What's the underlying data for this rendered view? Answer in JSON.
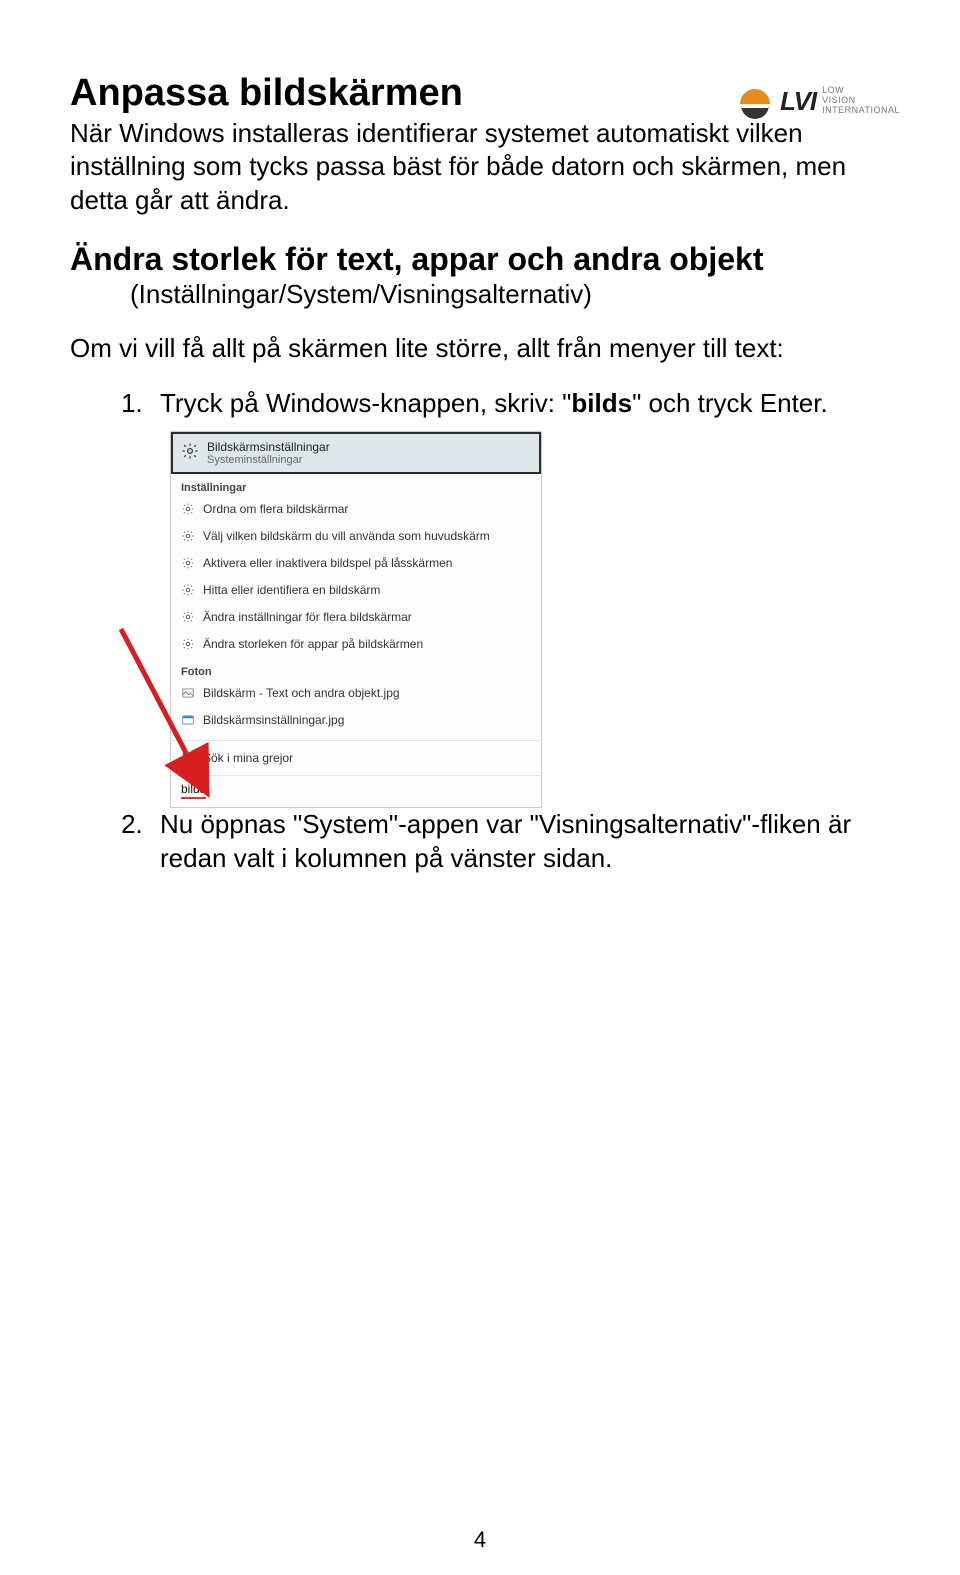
{
  "logo": {
    "brand": "LVI",
    "tag1": "LOW",
    "tag2": "VISION",
    "tag3": "INTERNATIONAL"
  },
  "title": "Anpassa bildskärmen",
  "intro": "När Windows installeras identifierar systemet automatiskt vilken inställning som tycks passa bäst för både datorn och skärmen, men detta går att ändra.",
  "subtitle": "Ändra storlek för text, appar och andra objekt",
  "crumb": "(Inställningar/System/Visningsalternativ)",
  "lead": "Om vi vill få allt på skärmen lite större, allt från menyer till text:",
  "step1a": "Tryck på Windows-knappen, skriv: \"",
  "step1b": "bilds",
  "step1c": "\" och tryck Enter.",
  "step2": "Nu öppnas \"System\"-appen var \"Visningsalternativ\"-fliken är redan valt i kolumnen på vänster sidan.",
  "shot": {
    "best_title": "Bildskärmsinställningar",
    "best_sub": "Systeminställningar",
    "cat_settings": "Inställningar",
    "r1": "Ordna om flera bildskärmar",
    "r2": "Välj vilken bildskärm du vill använda som huvudskärm",
    "r3": "Aktivera eller inaktivera bildspel på låsskärmen",
    "r4": "Hitta eller identifiera en bildskärm",
    "r5": "Ändra inställningar för flera bildskärmar",
    "r6": "Ändra storleken för appar på bildskärmen",
    "cat_photos": "Foton",
    "p1": "Bildskärm - Text och andra objekt.jpg",
    "p2": "Bildskärmsinställningar.jpg",
    "winrow": "Sök i mina grejor",
    "query": "bilds"
  },
  "page_number": "4"
}
